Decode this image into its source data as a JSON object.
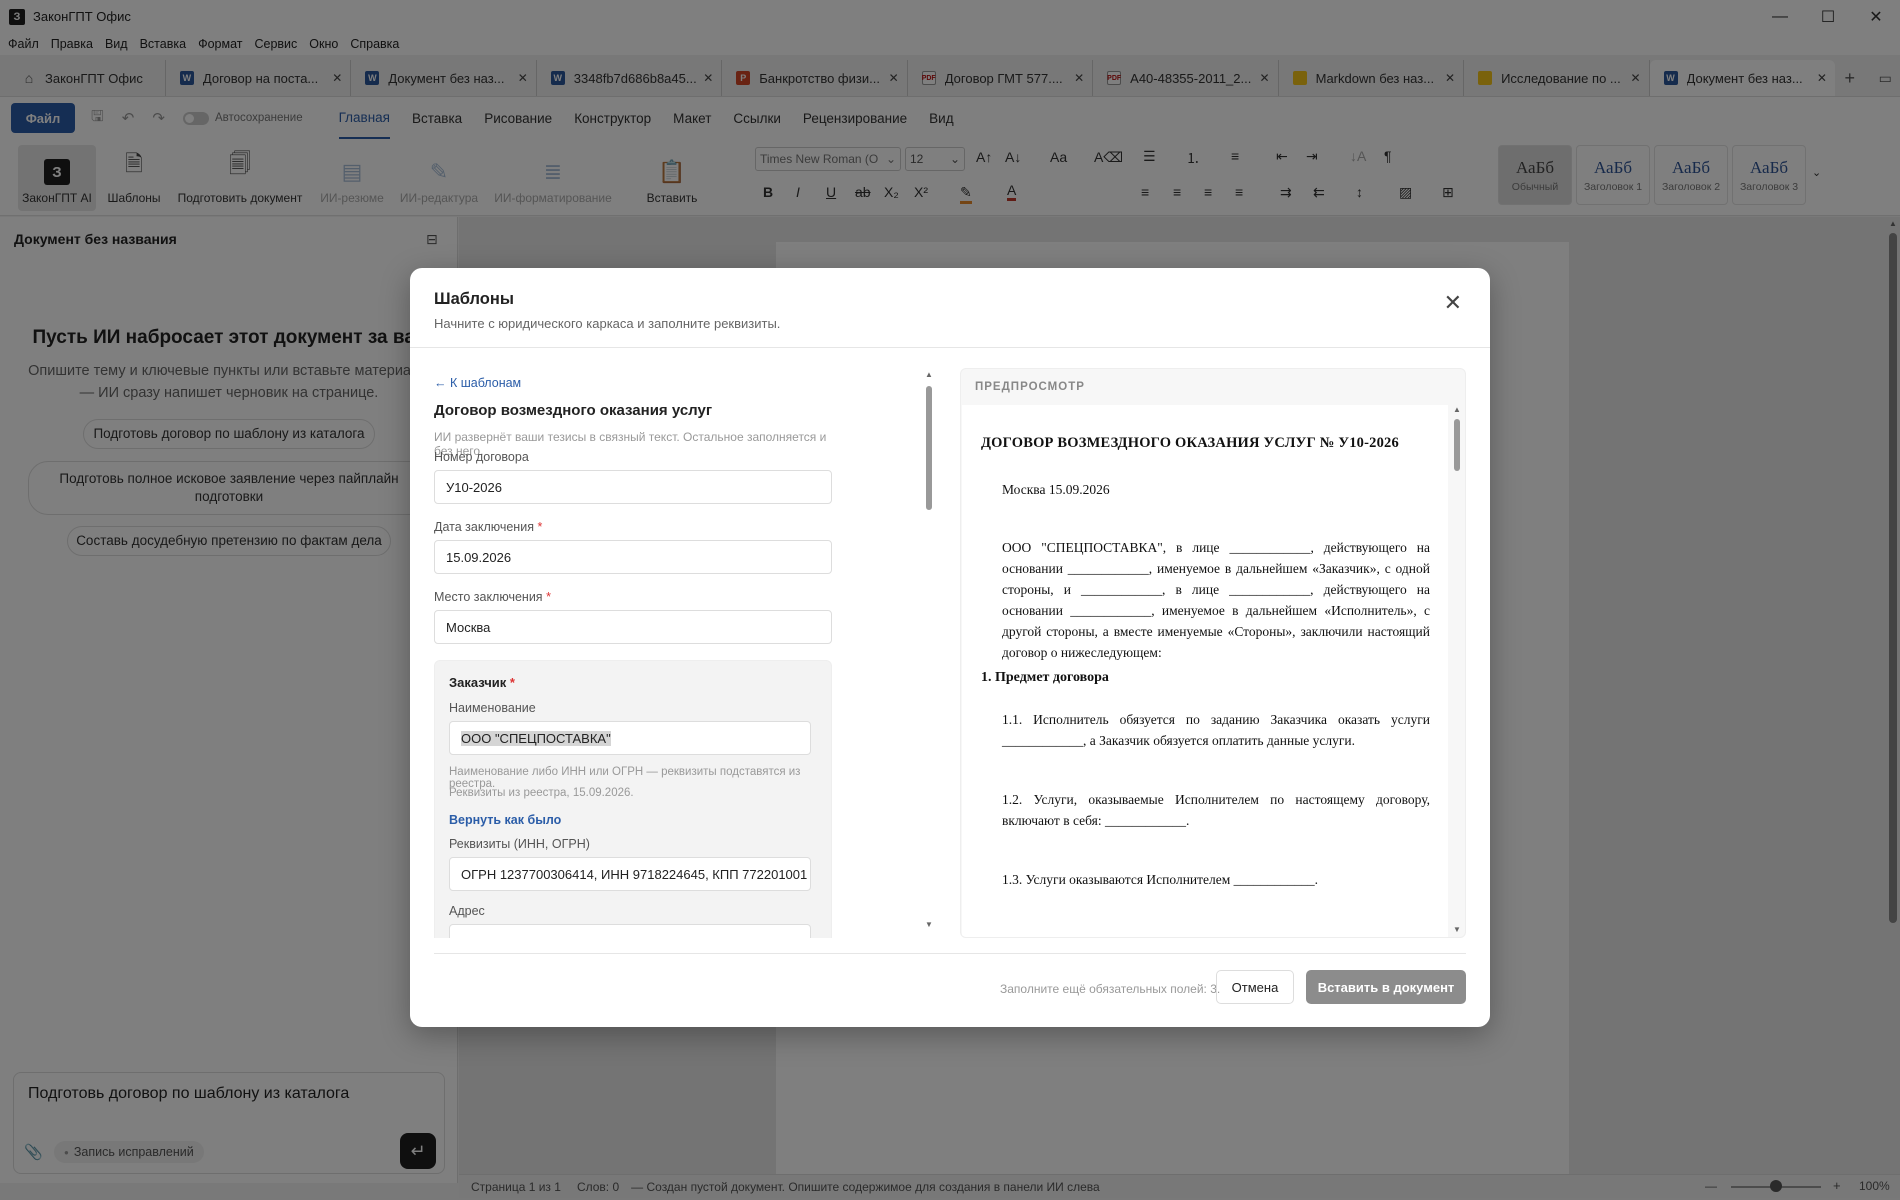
{
  "app": {
    "title": "ЗаконГПТ Офис",
    "logo_letter": "З"
  },
  "menu": [
    "Файл",
    "Правка",
    "Вид",
    "Вставка",
    "Формат",
    "Сервис",
    "Окно",
    "Справка"
  ],
  "tabs": [
    {
      "label": "ЗаконГПТ Офис",
      "icon": "home"
    },
    {
      "label": "Договор на поста...",
      "icon": "word"
    },
    {
      "label": "Документ без наз...",
      "icon": "word"
    },
    {
      "label": "3348fb7d686b8a45...",
      "icon": "word"
    },
    {
      "label": "Банкротство физи...",
      "icon": "ppt"
    },
    {
      "label": "Договор ГМТ 577....",
      "icon": "pdf"
    },
    {
      "label": "А40-48355-2011_2...",
      "icon": "pdf"
    },
    {
      "label": "Markdown без наз...",
      "icon": "note"
    },
    {
      "label": "Исследование по ...",
      "icon": "note"
    },
    {
      "label": "Документ без наз...",
      "icon": "word",
      "active": true
    }
  ],
  "ribbon_tabs": [
    "Главная",
    "Вставка",
    "Рисование",
    "Конструктор",
    "Макет",
    "Ссылки",
    "Рецензирование",
    "Вид"
  ],
  "file_button": "Файл",
  "autosave_label": "Автосохранение",
  "ribbon_buttons": {
    "zakon_ai": "ЗаконГПТ AI",
    "templates": "Шаблоны",
    "prepare": "Подготовить документ",
    "ai_summary": "ИИ-резюме",
    "ai_edit": "ИИ-редактура",
    "ai_format": "ИИ-форматирование",
    "paste": "Вставить"
  },
  "font": {
    "family": "Times New Roman (O",
    "size": "12"
  },
  "styles": [
    {
      "sample": "АаБб",
      "name": "Обычный"
    },
    {
      "sample": "АаБб",
      "name": "Заголовок 1"
    },
    {
      "sample": "АаБб",
      "name": "Заголовок 2"
    },
    {
      "sample": "АаБб",
      "name": "Заголовок 3"
    }
  ],
  "left_panel": {
    "title": "Документ без названия",
    "heading": "Пусть ИИ набросает этот документ за вас",
    "subtitle": "Опишите тему и ключевые пункты или вставьте материалы — ИИ сразу напишет черновик на странице.",
    "chips": [
      "Подготовь договор по шаблону из каталога",
      "Подготовь полное исковое заявление через пайплайн подготовки",
      "Составь досудебную претензию по фактам дела"
    ],
    "input_value": "Подготовь договор по шаблону из каталога",
    "track_changes": "Запись исправлений"
  },
  "status": {
    "page": "Страница 1 из 1",
    "words": "Слов: 0",
    "message": "— Создан пустой документ. Опишите содержимое для создания в панели ИИ слева",
    "zoom": "100%"
  },
  "modal": {
    "title": "Шаблоны",
    "subtitle": "Начните с юридического каркаса и заполните реквизиты.",
    "back": "← К шаблонам",
    "form_title": "Договор возмездного оказания услуг",
    "form_hint": "ИИ развернёт ваши тезисы в связный текст. Остальное заполняется и без него.",
    "fields": {
      "number_label": "Номер договора",
      "number_value": "У10-2026",
      "date_label": "Дата заключения",
      "date_value": "15.09.2026",
      "place_label": "Место заключения",
      "place_value": "Москва"
    },
    "customer": {
      "title": "Заказчик",
      "name_label": "Наименование",
      "name_value": "ООО \"СПЕЦПОСТАВКА\"",
      "hint": "Наименование либо ИНН или ОГРН — реквизиты подставятся из реестра.",
      "registry_note": "Реквизиты из реестра, 15.09.2026.",
      "revert": "Вернуть как было",
      "req_label": "Реквизиты (ИНН, ОГРН)",
      "req_value": "ОГРН 1237700306414, ИНН 9718224645, КПП 772201001",
      "address_label": "Адрес"
    },
    "preview": {
      "header": "ПРЕДПРОСМОТР",
      "title": "ДОГОВОР ВОЗМЕЗДНОГО ОКАЗАНИЯ УСЛУГ № У10-2026",
      "city_date": "Москва 15.09.2026",
      "intro": "ООО \"СПЕЦПОСТАВКА\", в лице ____________, действующего на основании ____________, именуемое в дальнейшем «Заказчик», с одной стороны, и ____________, в лице ____________, действующего на основании ____________, именуемое в дальнейшем «Исполнитель», с другой стороны, а вместе именуемые «Стороны», заключили настоящий договор о нижеследующем:",
      "section1": "1. Предмет договора",
      "p11": "1.1. Исполнитель обязуется по заданию Заказчика оказать услуги ____________, а Заказчик обязуется оплатить данные услуги.",
      "p12": "1.2. Услуги, оказываемые Исполнителем по настоящему договору, включают в себя: ____________.",
      "p13": "1.3. Услуги оказываются Исполнителем ____________."
    },
    "footer_note": "Заполните ещё обязательных полей: 3.",
    "cancel": "Отмена",
    "insert": "Вставить в документ"
  }
}
